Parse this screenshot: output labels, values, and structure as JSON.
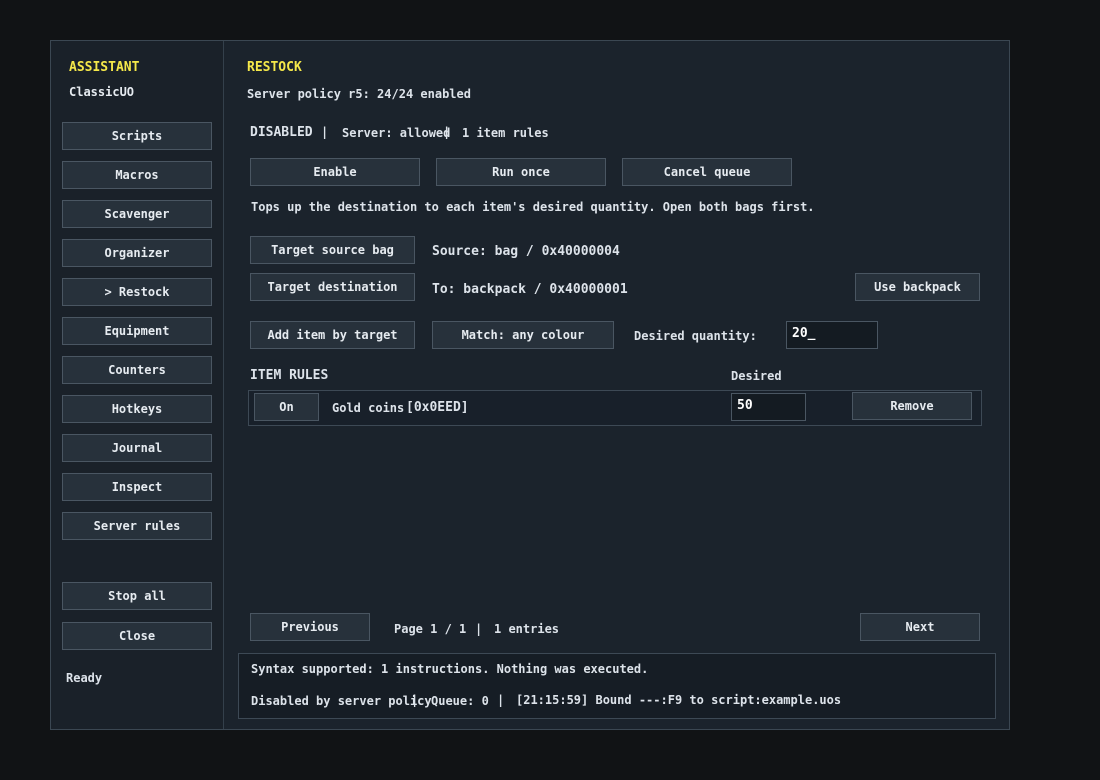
{
  "sidebar": {
    "title": "ASSISTANT",
    "subtitle": "ClassicUO",
    "nav": [
      {
        "label": "Scripts"
      },
      {
        "label": "Macros"
      },
      {
        "label": "Scavenger"
      },
      {
        "label": "Organizer"
      },
      {
        "label": "> Restock"
      },
      {
        "label": "Equipment"
      },
      {
        "label": "Counters"
      },
      {
        "label": "Hotkeys"
      },
      {
        "label": "Journal"
      },
      {
        "label": "Inspect"
      },
      {
        "label": "Server rules"
      }
    ],
    "stop_all": "Stop all",
    "close": "Close",
    "status": "Ready"
  },
  "main": {
    "title": "RESTOCK",
    "policy": "Server policy r5: 24/24 enabled",
    "state": "DISABLED",
    "server_status": "Server: allowed",
    "rule_count": "1 item rules",
    "sep": "|",
    "buttons": {
      "enable": "Enable",
      "run_once": "Run once",
      "cancel_queue": "Cancel queue",
      "target_source": "Target source bag",
      "target_dest": "Target destination",
      "use_backpack": "Use backpack",
      "add_item": "Add item by target",
      "match_colour": "Match: any colour"
    },
    "description": "Tops up the destination to each item's desired quantity. Open both bags first.",
    "source": "Source: bag / 0x40000004",
    "destination": "To: backpack / 0x40000001",
    "desired_quantity_label": "Desired quantity:",
    "desired_quantity_value": "20_",
    "item_rules_header": "ITEM RULES",
    "desired_header": "Desired",
    "rules": [
      {
        "toggle": "On",
        "name": "Gold coins",
        "id": "[0x0EED]",
        "desired": "50",
        "remove": "Remove"
      }
    ],
    "pager": {
      "previous": "Previous",
      "page": "Page 1 / 1",
      "entries": "1 entries",
      "next": "Next"
    },
    "console": {
      "line1": "Syntax supported: 1 instructions. Nothing was executed.",
      "status": "Disabled by server policy",
      "queue": "Queue: 0",
      "log": "[21:15:59] Bound ---:F9 to script:example.uos"
    }
  }
}
